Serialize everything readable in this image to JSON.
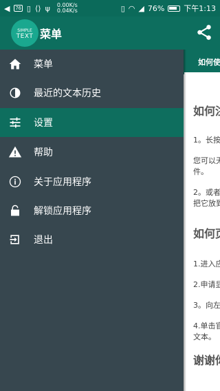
{
  "status_bar": {
    "speed_up": "0.00K/s",
    "speed_down": "0.04K/s",
    "box_label": "76",
    "battery_percent": "76%",
    "time": "下午1:13"
  },
  "app_bar": {
    "share_icon": "share-icon"
  },
  "drawer": {
    "logo_line1": "SIMPLE",
    "logo_line2": "TEXT",
    "title": "菜单",
    "items": [
      {
        "label": "菜单",
        "icon": "home-icon",
        "active": false
      },
      {
        "label": "最近的文本历史",
        "icon": "history-icon",
        "active": false
      },
      {
        "label": "设置",
        "icon": "settings-sliders-icon",
        "active": true
      },
      {
        "label": "帮助",
        "icon": "warning-icon",
        "active": false
      },
      {
        "label": "关于应用程序",
        "icon": "info-icon",
        "active": false
      },
      {
        "label": "解锁应用程序",
        "icon": "lock-icon",
        "active": false
      },
      {
        "label": "退出",
        "icon": "exit-icon",
        "active": false
      }
    ]
  },
  "content": {
    "tab_label": "如何使",
    "heading1": "如何注",
    "p1": "1。长按",
    "p2": "您可以无",
    "p2b": "件。",
    "p3": "2。或者",
    "p3b": "把它放到",
    "heading2": "如何页",
    "p4": "1.进入应",
    "p5": "2.申请显",
    "p6": "3。向左",
    "p7": "4.单击官",
    "p7b": "文本。",
    "heading3": "谢谢你"
  },
  "colors": {
    "primary": "#0d6e5e",
    "drawer_bg": "#37474f",
    "active_item": "#0e6e5e"
  }
}
